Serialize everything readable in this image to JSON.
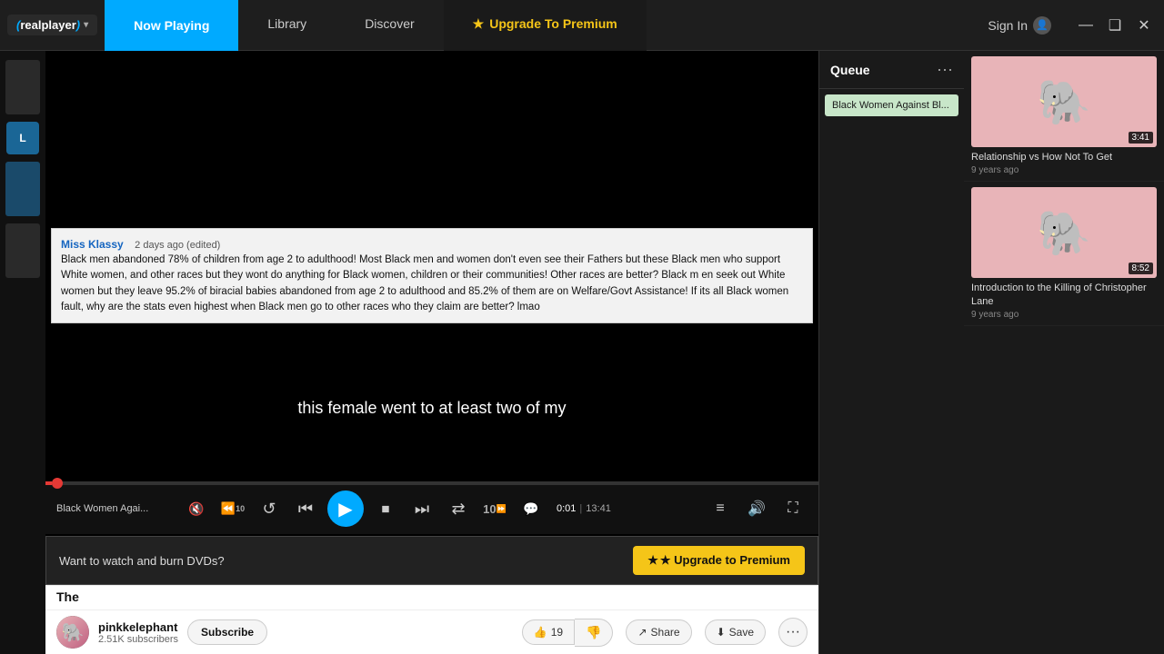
{
  "app": {
    "logo": "realplayer",
    "logo_chevron": "▾"
  },
  "nav": {
    "tabs": [
      {
        "id": "now-playing",
        "label": "Now Playing",
        "active": true,
        "premium": false
      },
      {
        "id": "library",
        "label": "Library",
        "active": false,
        "premium": false
      },
      {
        "id": "discover",
        "label": "Discover",
        "active": false,
        "premium": false
      },
      {
        "id": "upgrade",
        "label": "Upgrade To Premium",
        "active": false,
        "premium": true
      }
    ],
    "sign_in": "Sign In",
    "win_minimize": "—",
    "win_restore": "❑",
    "win_close": "✕"
  },
  "queue": {
    "title": "Queue",
    "more_icon": "···",
    "item": "Black Women Against Bl..."
  },
  "player": {
    "track_title": "Black Women Agai...",
    "progress_current": "0:01",
    "progress_total": "13:41",
    "subtitle": "this female went to at least two of my"
  },
  "comment": {
    "author": "Miss Klassy",
    "date": "2 days ago (edited)",
    "text": "Black men abandoned 78% of children from age 2 to adulthood! Most Black men and women don't even see their Fathers but these Black men who support White women, and other races but they wont do anything for Black women, children or their communities!  Other races are better? Black m en seek out White women but they leave 95.2% of biracial babies abandoned from age 2 to adulthood and 85.2% of them are on Welfare/Govt Assistance! If its all Black women fault,  why are the stats even highest when Black men go to other races who they claim are better? lmao"
  },
  "controls": {
    "rewind_label": "⟲",
    "back10_label": "⏪",
    "forward_label": "⟳",
    "prev_label": "⏮",
    "play_label": "▶",
    "stop_label": "⏹",
    "next_label": "⏭",
    "shuffle_label": "⇄",
    "forward10_label": "10",
    "cc_label": "💬",
    "eq_label": "≡",
    "volume_label": "🔊",
    "fullscreen_label": "⛶"
  },
  "dvd_promo": {
    "text": "Want to watch and burn DVDs?",
    "button": "★ Upgrade to Premium"
  },
  "channel": {
    "name": "pinkkelephant",
    "subs": "2.51K subscribers",
    "subscribe": "Subscribe",
    "likes": "19",
    "share": "Share",
    "save": "Save",
    "more": "···"
  },
  "page_title": "The",
  "thumbnails": [
    {
      "title": "Relationship vs How Not To Get",
      "meta": "9 years ago",
      "duration": "3:41",
      "has_elephant": true
    },
    {
      "title": "Introduction to the Killing of Christopher Lane",
      "meta": "9 years ago",
      "duration": "8:52",
      "has_elephant": true
    }
  ]
}
